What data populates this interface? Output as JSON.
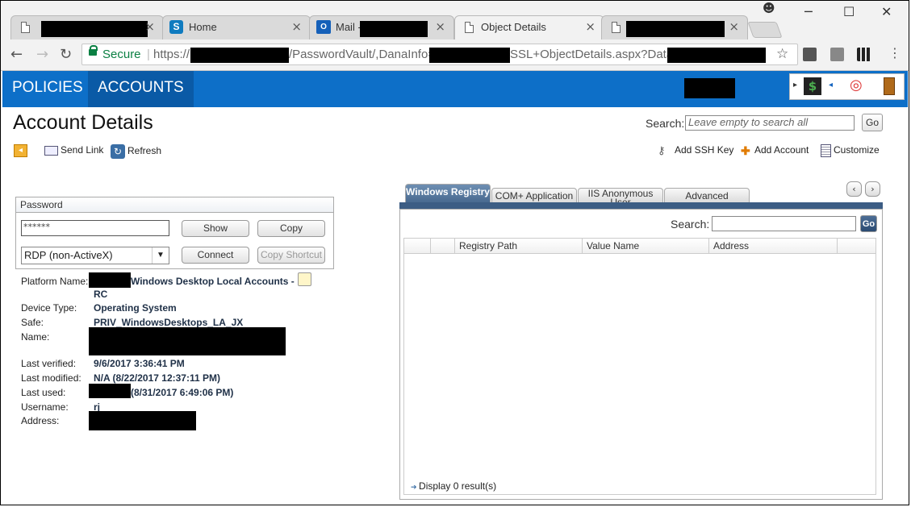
{
  "browser": {
    "tabs": [
      {
        "title": ""
      },
      {
        "title": "Home"
      },
      {
        "title": "Mail -"
      },
      {
        "title": "Object Details"
      },
      {
        "title": ""
      }
    ],
    "tab_close": "×",
    "url": {
      "secure_label": "Secure",
      "prefix": "https://",
      "part2": "/PasswordVault/,DanaInfo=",
      "part3": "SSL+ObjectDetails.aspx?Data="
    }
  },
  "app": {
    "nav": [
      {
        "label": "POLICIES"
      },
      {
        "label": "ACCOUNTS"
      }
    ],
    "page_title": "Account Details",
    "search": {
      "label": "Search:",
      "placeholder": "Leave empty to search all",
      "go": "Go"
    },
    "actions": {
      "send_link": "Send Link",
      "refresh": "Refresh",
      "add_ssh_key": "Add SSH Key",
      "add_account": "Add Account",
      "customize": "Customize"
    },
    "password": {
      "header": "Password",
      "value": "******",
      "show": "Show",
      "copy": "Copy",
      "connection_type": "RDP (non-ActiveX)",
      "connect": "Connect",
      "copy_shortcut": "Copy Shortcut"
    },
    "details": {
      "platform_label": "Platform Name:",
      "platform_value": "Windows Desktop Local Accounts -",
      "platform_value_2": "RC",
      "device_label": "Device Type:",
      "device_value": "Operating System",
      "safe_label": "Safe:",
      "safe_value": "PRIV_WindowsDesktops_LA_JX",
      "name_label": "Name:",
      "verified_label": "Last verified:",
      "verified_value": "9/6/2017 3:36:41 PM",
      "modified_label": "Last modified:",
      "modified_value": "N/A (8/22/2017 12:37:11 PM)",
      "used_label": "Last used:",
      "used_value": "(8/31/2017 6:49:06 PM)",
      "username_label": "Username:",
      "username_value": "rj",
      "address_label": "Address:"
    },
    "right_panel": {
      "tabs": [
        {
          "label": "Windows Registry"
        },
        {
          "label": "COM+ Application"
        },
        {
          "label": "IIS Anonymous User"
        },
        {
          "label": "Advanced"
        }
      ],
      "search_label": "Search:",
      "go": "Go",
      "columns": [
        "Registry Path",
        "Value Name",
        "Address"
      ],
      "footer": "Display 0 result(s)"
    }
  },
  "colors": {
    "nav_bg": "#0d6fc8",
    "nav_active": "#0a5aa6",
    "secure": "#0b8043",
    "tab_active": "#3c5d84"
  }
}
